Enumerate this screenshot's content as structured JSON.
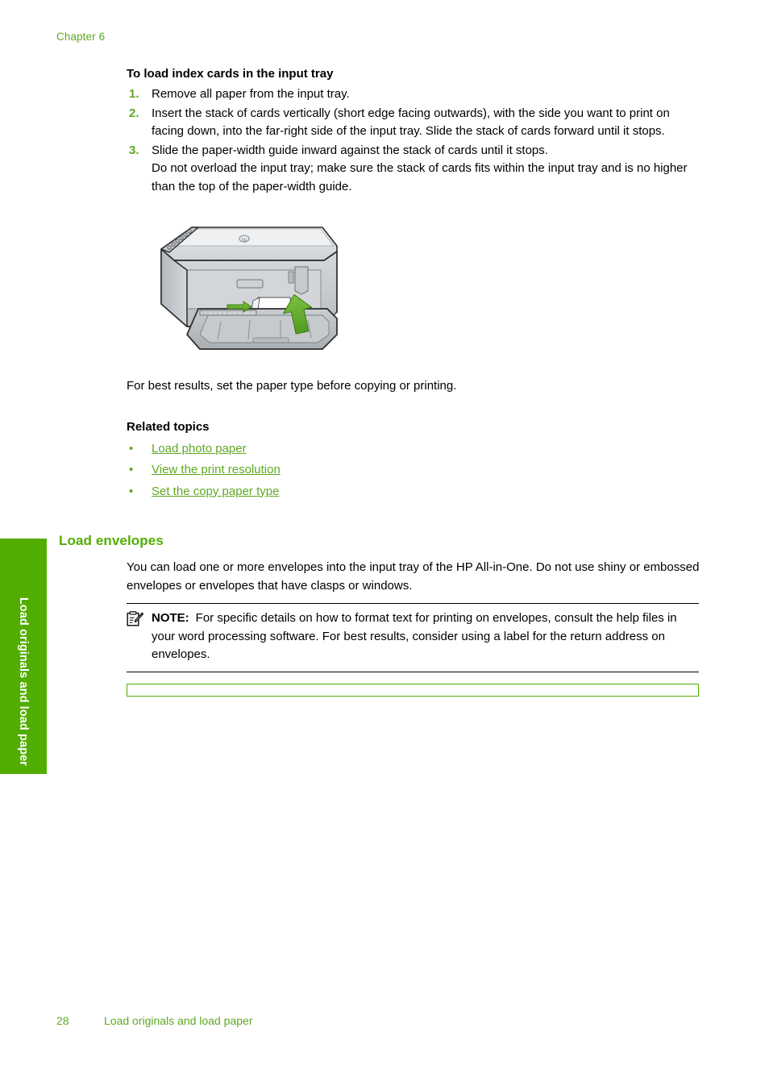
{
  "header": {
    "chapter": "Chapter 6"
  },
  "side_tab": {
    "label": "Load originals and load paper",
    "color": "#51ad00"
  },
  "procedure": {
    "title": "To load index cards in the input tray",
    "steps": [
      {
        "number": "1.",
        "text": "Remove all paper from the input tray."
      },
      {
        "number": "2.",
        "text": "Insert the stack of cards vertically (short edge facing outwards), with the side you want to print on facing down, into the far-right side of the input tray. Slide the stack of cards forward until it stops."
      },
      {
        "number": "3.",
        "text": "Slide the paper-width guide inward against the stack of cards until it stops.",
        "sub_text": "Do not overload the input tray; make sure the stack of cards fits within the input tray and is no higher than the top of the paper-width guide."
      }
    ]
  },
  "figure": {
    "name": "hp-all-in-one-printer-load-index-cards-illustration",
    "brand_mark": "hp",
    "arrows": [
      "paper-width-guide-arrow-right",
      "insert-cards-arrow-up-left"
    ]
  },
  "after_figure": {
    "text": "For best results, set the paper type before copying or printing."
  },
  "related": {
    "title": "Related topics",
    "bullet": "•",
    "links": [
      "Load photo paper",
      "View the print resolution",
      "Set the copy paper type"
    ]
  },
  "section": {
    "heading": "Load envelopes",
    "body": "You can load one or more envelopes into the input tray of the HP All-in-One. Do not use shiny or embossed envelopes or envelopes that have clasps or windows."
  },
  "note": {
    "icon": "note-clipboard-pencil-icon",
    "label": "NOTE:",
    "text": "For specific details on how to format text for printing on envelopes, consult the help files in your word processing software. For best results, consider using a label for the return address on envelopes."
  },
  "green_box": {
    "name": "empty-green-outlined-box",
    "content": "",
    "border_color": "#51ad00"
  },
  "footer": {
    "page_number": "28",
    "section_title": "Load originals and load paper"
  },
  "colors": {
    "accent_green": "#51ad00",
    "text_green": "#5fa822",
    "body_text": "#000000"
  }
}
